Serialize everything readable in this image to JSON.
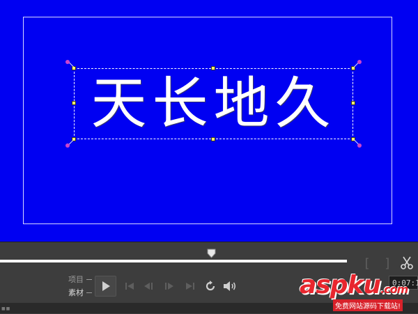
{
  "preview": {
    "background_color": "#0000f2",
    "title_text": "天长地久",
    "title_text_color": "#ffffff"
  },
  "timeline": {
    "position_fraction": 0.61
  },
  "controls": {
    "mode_project_label": "项目",
    "mode_clip_label": "素材",
    "in_mark": "[",
    "out_mark": "]",
    "timecode": "0:07:1"
  },
  "icons": {
    "scissors": "scissors-icon",
    "play": "play-icon",
    "go_start": "go-to-start-icon",
    "step_back": "step-back-icon",
    "step_forward": "step-forward-icon",
    "go_end": "go-to-end-icon",
    "repeat": "repeat-icon",
    "volume": "volume-icon"
  },
  "watermark": {
    "logo": "aspku",
    "logo_suffix": ".com",
    "subtitle": "免费网站源码下载站!",
    "accent_color": "#e8262e"
  }
}
